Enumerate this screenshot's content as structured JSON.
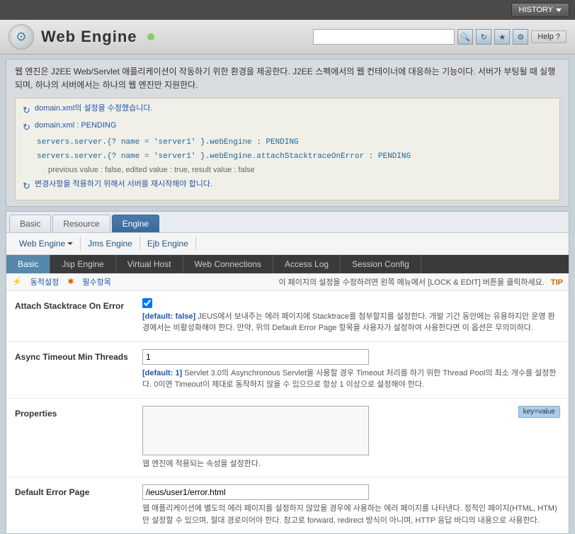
{
  "topbar": {
    "history_label": "HISTORY"
  },
  "header": {
    "title": "Web  Engine",
    "search_placeholder": ""
  },
  "help": {
    "label": "Help",
    "icon": "?"
  },
  "info": {
    "main_text": "웹 엔진은 J2EE Web/Servlet 애플리케이션이 작동하기 위한 환경을 제공한다. J2EE 스펙에서의 웹 컨테이너에 대응하는 기능이다. 서버가 부팅될 때 실행되며, 하나의 서버에서는 하나의 웹 엔진만 지원한다.",
    "line1": "domain.xml의 설정을 수정했습니다.",
    "line2": "domain.xml : PENDING",
    "line3": "servers.server.{? name = 'server1' }.webEngine : PENDING",
    "line4": "servers.server.{? name = 'server1' }.webEngine.attachStacktraceOnError : PENDING",
    "line5": "previous value : false, edited value : true, result value : false",
    "line6": "변경사항을 적용하기 위해서 서버를 재시작해야 합니다."
  },
  "main_tabs": [
    {
      "id": "basic",
      "label": "Basic"
    },
    {
      "id": "resource",
      "label": "Resource"
    },
    {
      "id": "engine",
      "label": "Engine"
    }
  ],
  "sub_tabs": [
    {
      "id": "web-engine",
      "label": "Web Engine",
      "has_arrow": true
    },
    {
      "id": "jms-engine",
      "label": "Jms Engine"
    },
    {
      "id": "ejb-engine",
      "label": "Ejb Engine"
    }
  ],
  "content_tabs": [
    {
      "id": "basic",
      "label": "Basic"
    },
    {
      "id": "jsp-engine",
      "label": "Jsp Engine"
    },
    {
      "id": "virtual-host",
      "label": "Virtual Host"
    },
    {
      "id": "web-connections",
      "label": "Web Connections"
    },
    {
      "id": "access-log",
      "label": "Access Log"
    },
    {
      "id": "session-config",
      "label": "Session Config"
    }
  ],
  "status_bar": {
    "dynamic_setting": "동적설정",
    "required_items": "필수항목",
    "instruction": "이 페이지의 설정을 수정하려면 왼쪽 메뉴에서 [LOCK & EDIT] 버튼을 클릭하세요.",
    "tip": "TIP"
  },
  "form_rows": [
    {
      "id": "attach-stacktrace",
      "label": "Attach Stacktrace On Error",
      "type": "checkbox",
      "checked": true,
      "default_text": "[default: false]",
      "desc": "JEUS에서 보내주는 에러 페이지에 Stacktrace를 첨부할지를 설정한다. 개발 기간 동안에는 유용하지만 운영 환경에서는 비활성화해야 한다. 만약, 위의 Default Error Page 항목을 사용자가 설정하여 사용한다면 이 옵션은 무의미하다."
    },
    {
      "id": "async-timeout",
      "label": "Async Timeout Min Threads",
      "type": "text",
      "value": "1",
      "default_text": "[default: 1]",
      "desc": "Servlet 3.0의 Asynchronous Servlet을 사용할 경우 Timeout 처리를 하기 위한 Thread Pool의 최소 개수를 설정한다. 0이면 Timeout이 제대로 동작하지 않을 수 있으므로 항상 1 이상으로 설정해야 한다."
    },
    {
      "id": "properties",
      "label": "Properties",
      "type": "textarea",
      "value": "",
      "key_value_label": "key=value",
      "desc": "웹 엔진에 적용되는 속성을 설정한다."
    },
    {
      "id": "default-error-page",
      "label": "Default Error Page",
      "type": "text",
      "value": "/ieus/user1/error.html",
      "desc": "웹 애플리케이션에 별도의 에러 페이지를 설정하지 않았을 경우에 사용하는 에러 페이지를 나타낸다. 정적인 페이지(HTML, HTM)만 설정할 수 있으며, 절대 경로이어야 한다. 참고로 forward, redirect 방식이 아니며, HTTP 응답 바디의 내용으로 사용한다."
    }
  ]
}
